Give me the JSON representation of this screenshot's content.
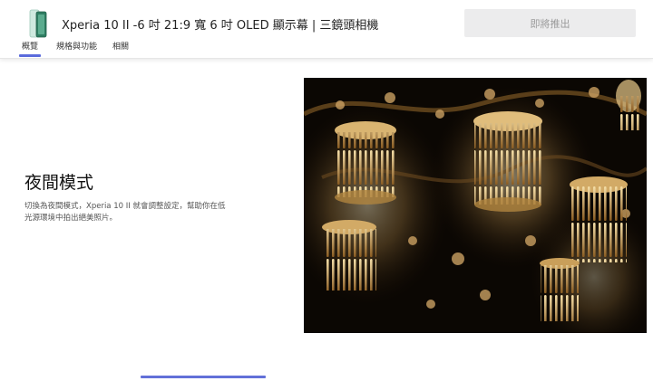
{
  "header": {
    "product_title": "Xperia 10 II -6 吋 21:9 寬 6 吋 OLED 顯示幕 | 三鏡頭相機",
    "cta_label": "即將推出"
  },
  "tabs": [
    {
      "label": "概覽",
      "active": true
    },
    {
      "label": "規格與功能",
      "active": false
    },
    {
      "label": "相關",
      "active": false
    }
  ],
  "feature": {
    "title": "夜間模式",
    "description": "切換為夜間模式，Xperia 10 II 就會調整設定，幫助你在低光源環境中拍出絕美照片。"
  },
  "icons": {
    "product_thumbnail": "phone-thumbnail-icon",
    "photo": "chandelier-photo"
  },
  "colors": {
    "accent": "#5b6bdc",
    "cta_bg": "#ececed",
    "cta_text": "#9a9a9a",
    "photo_bg": "#0b0703",
    "chandelier_glow": "#e8c98a"
  }
}
